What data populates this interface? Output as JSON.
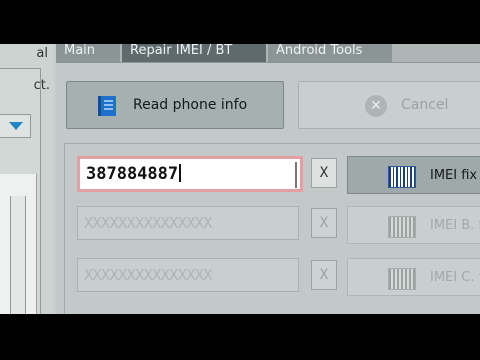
{
  "left_panel": {
    "title_fragment": "al",
    "text_fragment": "ct."
  },
  "tabs": [
    {
      "label": "Main"
    },
    {
      "label": "Repair IMEI / BT"
    },
    {
      "label": "Android Tools"
    }
  ],
  "buttons": {
    "read_phone_info": "Read phone info",
    "cancel": "Cancel"
  },
  "imei_rows": [
    {
      "value": "387884887",
      "clear": "X",
      "fix_label": "IMEI fix",
      "enabled": true
    },
    {
      "value": "XXXXXXXXXXXXXXX",
      "clear": "X",
      "fix_label": "IMEI B. fix",
      "enabled": false
    },
    {
      "value": "XXXXXXXXXXXXXXX",
      "clear": "X",
      "fix_label": "IMEI C. fix",
      "enabled": false
    }
  ],
  "colors": {
    "accent": "#1e86c4",
    "input_border_focus": "#e59ea3"
  }
}
